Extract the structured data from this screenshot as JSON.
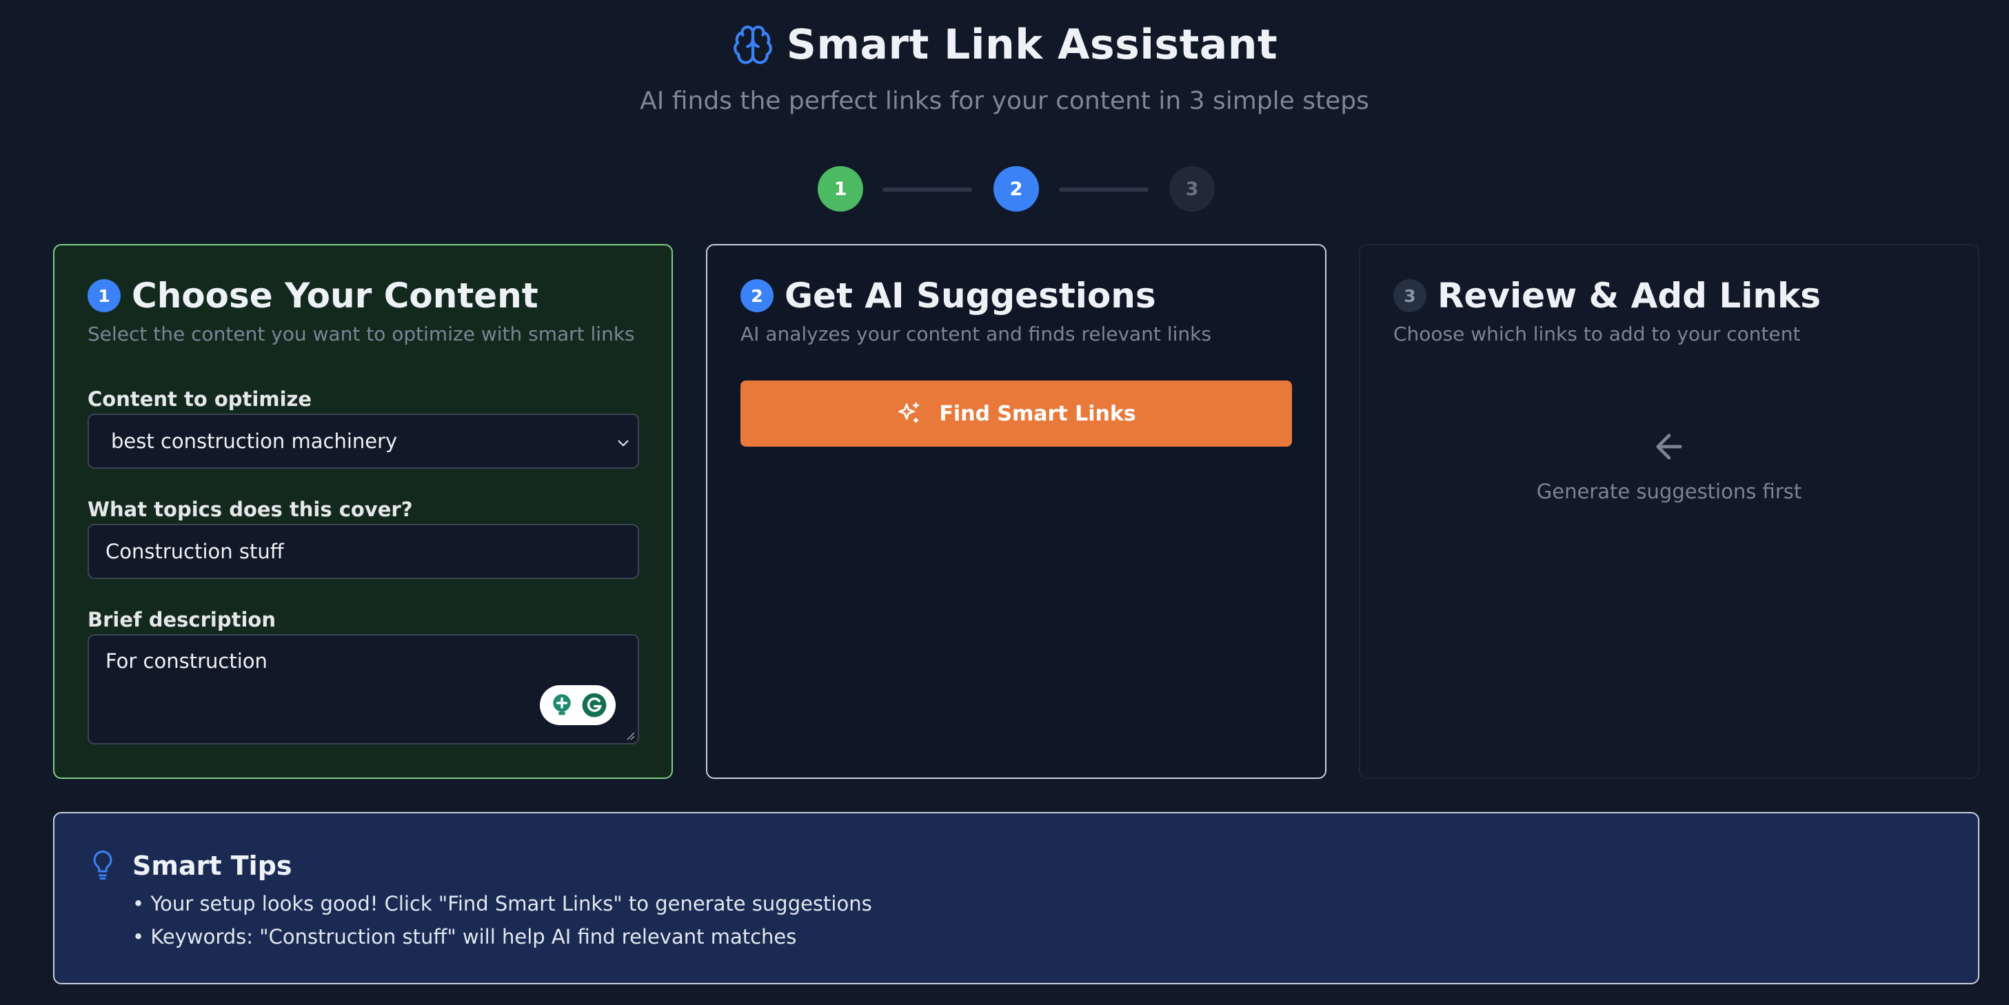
{
  "header": {
    "title": "Smart Link Assistant",
    "subtitle": "AI finds the perfect links for your content in 3 simple steps"
  },
  "stepper": {
    "steps": [
      {
        "label": "1",
        "state": "completed"
      },
      {
        "label": "2",
        "state": "active"
      },
      {
        "label": "3",
        "state": "pending"
      }
    ]
  },
  "step1": {
    "number": "1",
    "title": "Choose Your Content",
    "description": "Select the content you want to optimize with smart links",
    "content_label": "Content to optimize",
    "content_value": "best construction machinery",
    "topics_label": "What topics does this cover?",
    "topics_value": "Construction stuff",
    "description_label": "Brief description",
    "description_value": "For construction"
  },
  "step2": {
    "number": "2",
    "title": "Get AI Suggestions",
    "description": "AI analyzes your content and finds relevant links",
    "button_label": "Find Smart Links"
  },
  "step3": {
    "number": "3",
    "title": "Review & Add Links",
    "description": "Choose which links to add to your content",
    "empty_text": "Generate suggestions first"
  },
  "tips": {
    "title": "Smart Tips",
    "items": [
      "• Your setup looks good! Click \"Find Smart Links\" to generate suggestions",
      "• Keywords: \"Construction stuff\" will help AI find relevant matches"
    ]
  },
  "colors": {
    "background": "#111827",
    "accent_blue": "#3b82f6",
    "success_green": "#4cb963",
    "button_orange": "#e8793a",
    "tips_background": "#1b2a52"
  },
  "icons": [
    "brain-icon",
    "sparkle-icon",
    "arrow-left-icon",
    "lightbulb-icon",
    "chevron-down-icon",
    "grammarly-icon"
  ]
}
